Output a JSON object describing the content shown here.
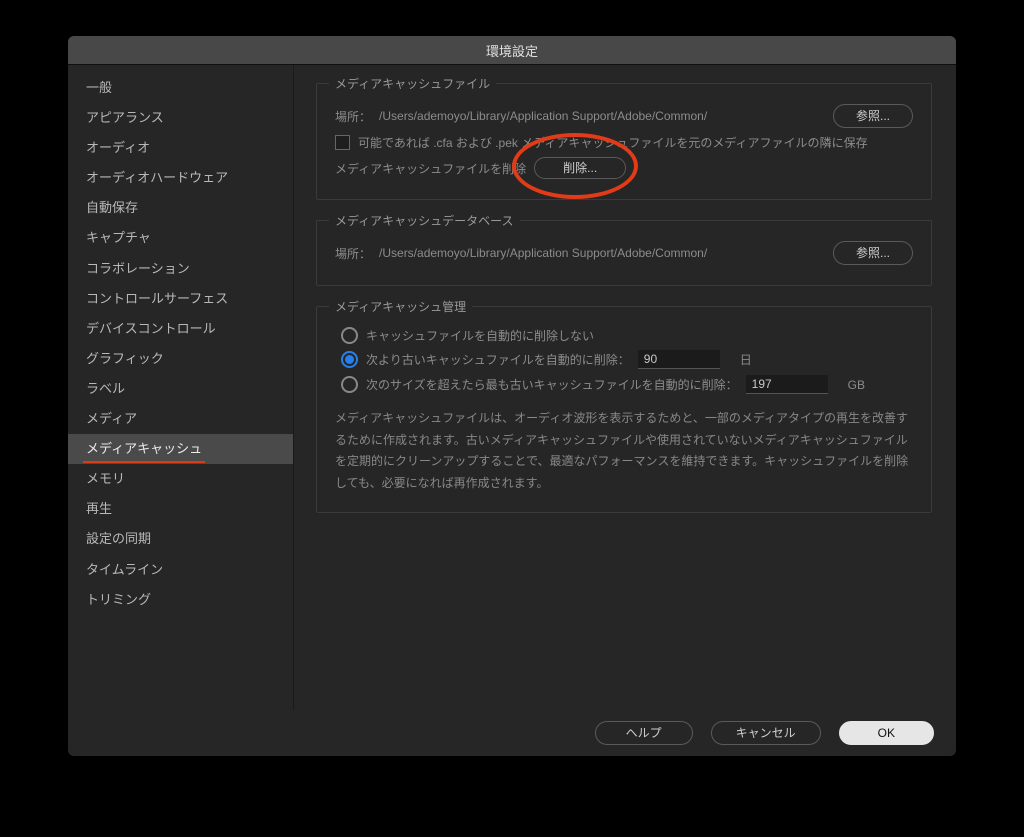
{
  "window": {
    "title": "環境設定"
  },
  "sidebar": {
    "items": [
      "一般",
      "アピアランス",
      "オーディオ",
      "オーディオハードウェア",
      "自動保存",
      "キャプチャ",
      "コラボレーション",
      "コントロールサーフェス",
      "デバイスコントロール",
      "グラフィック",
      "ラベル",
      "メディア",
      "メディアキャッシュ",
      "メモリ",
      "再生",
      "設定の同期",
      "タイムライン",
      "トリミング"
    ],
    "selected_index": 12
  },
  "groups": {
    "cache_files": {
      "title": "メディアキャッシュファイル",
      "location_label": "場所：",
      "location_value": "/Users/ademoyo/Library/Application Support/Adobe/Common/",
      "browse": "参照...",
      "checkbox_label": "可能であれば .cfa および .pek メディアキャッシュファイルを元のメディアファイルの隣に保存",
      "delete_label": "メディアキャッシュファイルを削除",
      "delete_button": "削除..."
    },
    "cache_db": {
      "title": "メディアキャッシュデータベース",
      "location_label": "場所：",
      "location_value": "/Users/ademoyo/Library/Application Support/Adobe/Common/",
      "browse": "参照..."
    },
    "cache_mgmt": {
      "title": "メディアキャッシュ管理",
      "opt_none": "キャッシュファイルを自動的に削除しない",
      "opt_age_prefix": "次より古いキャッシュファイルを自動的に削除：",
      "age_value": "90",
      "age_unit": "日",
      "opt_size_prefix": "次のサイズを超えたら最も古いキャッシュファイルを自動的に削除：",
      "size_value": "197",
      "size_unit": "GB",
      "description": "メディアキャッシュファイルは、オーディオ波形を表示するためと、一部のメディアタイプの再生を改善するために作成されます。古いメディアキャッシュファイルや使用されていないメディアキャッシュファイルを定期的にクリーンアップすることで、最適なパフォーマンスを維持できます。キャッシュファイルを削除しても、必要になれば再作成されます。"
    }
  },
  "footer": {
    "help": "ヘルプ",
    "cancel": "キャンセル",
    "ok": "OK"
  }
}
